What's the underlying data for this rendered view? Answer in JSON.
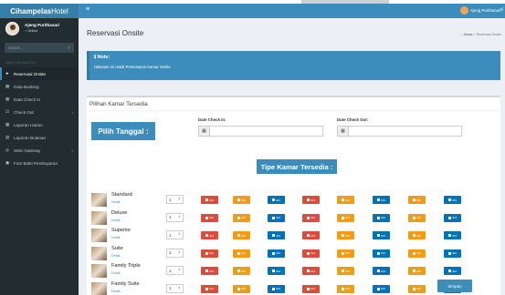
{
  "app": {
    "logo_bold": "Cihampelas",
    "logo_rest": "Hotel"
  },
  "sidebar": {
    "user_name": "Ajeng Purithasari",
    "user_status": "Online",
    "search_placeholder": "Search...",
    "nav_header": "MAIN NAVIGATION",
    "items": [
      {
        "label": "Reservasi Onsite",
        "icon": "arrow-icon",
        "active": true
      },
      {
        "label": "Data Booking",
        "icon": "table-icon"
      },
      {
        "label": "Data Check In",
        "icon": "table-icon"
      },
      {
        "label": "Check Out",
        "icon": "edit-icon",
        "chevron": true
      },
      {
        "label": "Laporan Harian",
        "icon": "table-icon"
      },
      {
        "label": "Laporan Bulanan",
        "icon": "chart-icon"
      },
      {
        "label": "SMS Gateway",
        "icon": "circle-icon",
        "chevron": true
      },
      {
        "label": "Foto Bukti Pembayaran",
        "icon": "image-icon"
      }
    ]
  },
  "header": {
    "user_name": "Ajeng Purithasari"
  },
  "page": {
    "title": "Reservasi Onsite",
    "breadcrumb_home": "Home",
    "breadcrumb_current": "Reservasi Onsite"
  },
  "note": {
    "title": "Note:",
    "text": "Halaman ini untuk Pemesanan Kamar Onsite"
  },
  "panel": {
    "title": "Pilihan Kamar Tersedia",
    "pick_date_label": "Pilih Tanggal :",
    "checkin_label": "Date Check In:",
    "checkout_label": "Date Check Out:",
    "room_types_label": "Tipe Kamar Tersedia :",
    "detail_label": "Detail...",
    "save_label": "Simpan"
  },
  "rooms": [
    {
      "name": "Standard",
      "qty": "1",
      "badges": [
        "red",
        "orange",
        "blue",
        "red",
        "orange",
        "blue",
        "orange",
        "blue"
      ]
    },
    {
      "name": "Deluxe",
      "qty": "1",
      "badges": [
        "red",
        "orange",
        "blue",
        "red",
        "orange",
        "blue",
        "orange",
        "blue"
      ]
    },
    {
      "name": "Superior",
      "qty": "1",
      "badges": [
        "red",
        "orange",
        "blue",
        "red",
        "orange",
        "blue",
        "orange",
        "blue"
      ]
    },
    {
      "name": "Suite",
      "qty": "1",
      "badges": [
        "red",
        "orange",
        "blue",
        "red",
        "orange",
        "blue",
        "orange",
        "blue"
      ]
    },
    {
      "name": "Family Triple",
      "qty": "1",
      "badges": [
        "red",
        "orange",
        "blue",
        "red",
        "orange",
        "blue",
        "orange",
        "blue"
      ]
    },
    {
      "name": "Family Suite",
      "qty": "1",
      "badges": [
        "red",
        "orange",
        "blue",
        "red",
        "orange",
        "blue",
        "orange",
        "blue"
      ]
    }
  ],
  "badge_text": "404",
  "colors": {
    "primary": "#3c8dbc",
    "sidebar": "#222d32",
    "red": "#dd4b39",
    "orange": "#f39c12",
    "blue": "#0073b7"
  }
}
